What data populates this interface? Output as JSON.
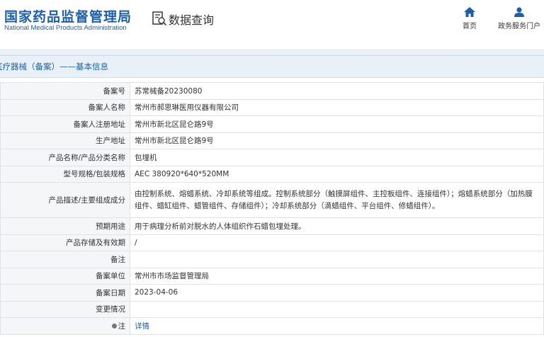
{
  "header": {
    "logo_cn": "国家药品监督管理局",
    "logo_en": "National Medical Products Administration",
    "query_title": "数据查询",
    "nav": [
      {
        "label": "首页",
        "icon": "home-icon"
      },
      {
        "label": "政务服务门户",
        "icon": "user-icon"
      }
    ]
  },
  "section": {
    "title": "医疗器械（备案）——基本信息"
  },
  "rows": [
    {
      "label": "备案号",
      "value": "苏常械备20230080"
    },
    {
      "label": "备案人名称",
      "value": "常州市郝思琳医用仪器有限公司"
    },
    {
      "label": "备案人注册地址",
      "value": "常州市新北区昆仑路9号"
    },
    {
      "label": "生产地址",
      "value": "常州市新北区昆仑路9号"
    },
    {
      "label": "产品名称/产品分类名称",
      "value": "包埋机"
    },
    {
      "label": "型号规格/包装规格",
      "value": "AEC 380920*640*520MM"
    },
    {
      "label": "产品描述/主要组成成分",
      "value": "由控制系统、熔蜡系统、冷却系统等组成。控制系统部分（触摸屏组件、主控板组件、连接组件）；熔蜡系统部分（加热膜组件、蜡缸组件、蜡管组件、存储组件）；冷却系统部分（滴蜡组件、平台组件、修蜡组件）。"
    },
    {
      "label": "预期用途",
      "value": "用于病理分析前对脱水的人体组织作石蜡包埋处理。"
    },
    {
      "label": "产品存储及有效期",
      "value": "/"
    },
    {
      "label": "备注",
      "value": ""
    },
    {
      "label": "备案单位",
      "value": "常州市市场监督管理局"
    },
    {
      "label": "备案日期",
      "value": "2023-04-06"
    },
    {
      "label": "变更情况",
      "value": ""
    },
    {
      "label": "注",
      "value": "详情"
    }
  ],
  "colors": {
    "brand": "#1e5fa8",
    "label_bg": "#f5f6f8",
    "section_bg": "#e9f0f7"
  }
}
